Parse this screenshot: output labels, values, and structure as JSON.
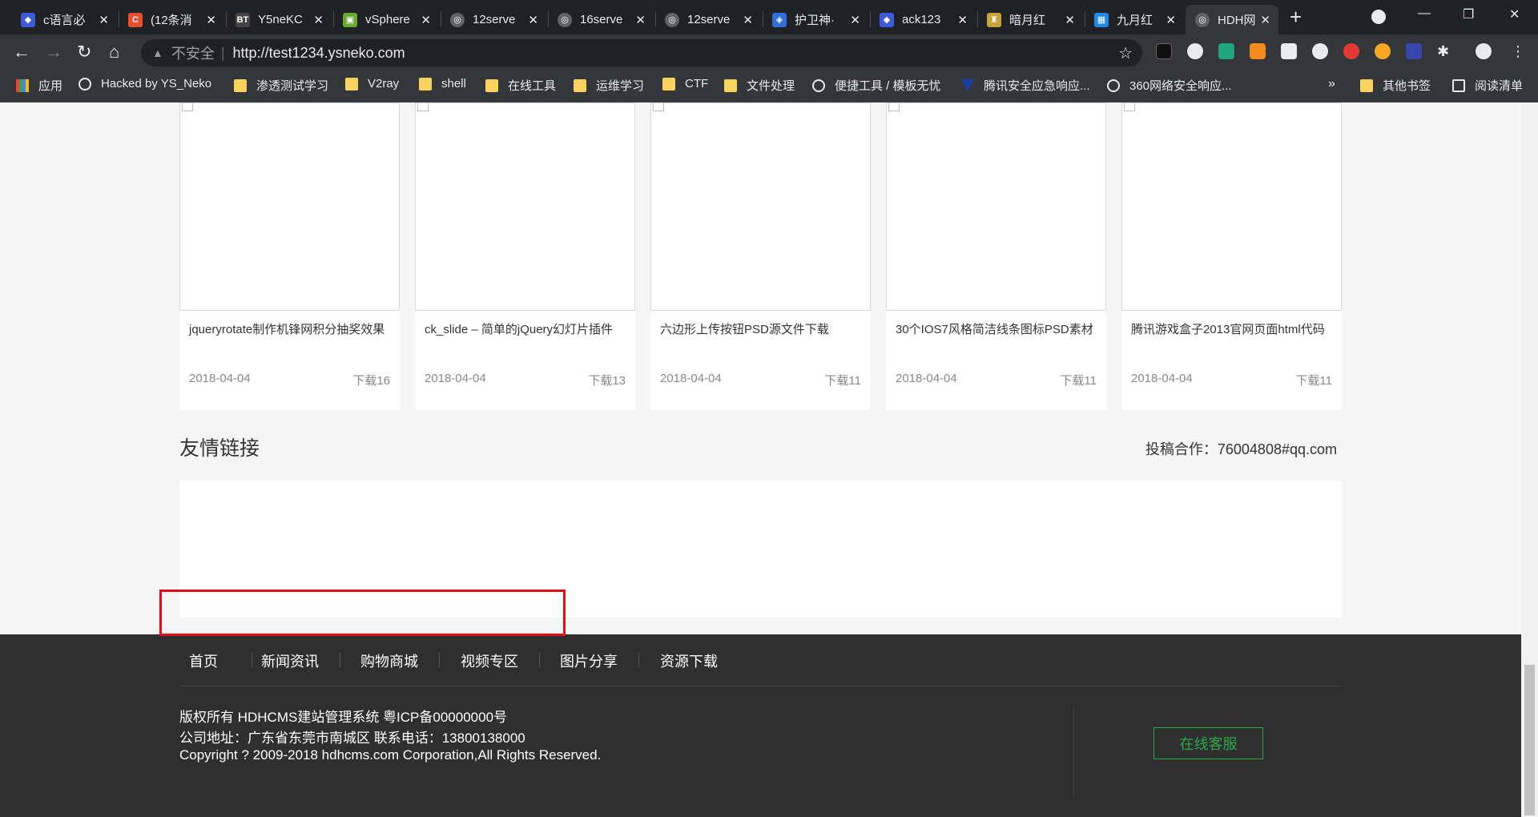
{
  "browser": {
    "tabs": [
      {
        "label": "c语言必",
        "color": "#3b5bdb",
        "glyph": "◆"
      },
      {
        "label": "(12条消",
        "color": "#e8502d",
        "glyph": "C"
      },
      {
        "label": "Y5neKC",
        "color": "#444444",
        "glyph": "BT"
      },
      {
        "label": "vSphere",
        "color": "#6aa92f",
        "glyph": "▣"
      },
      {
        "label": "12serve",
        "color": "#9aa0a6",
        "glyph": "◎"
      },
      {
        "label": "16serve",
        "color": "#9aa0a6",
        "glyph": "◎"
      },
      {
        "label": "12serve",
        "color": "#9aa0a6",
        "glyph": "◎"
      },
      {
        "label": "护卫神·",
        "color": "#2f6fd6",
        "glyph": "◈"
      },
      {
        "label": "ack123",
        "color": "#3b5bdb",
        "glyph": "◆"
      },
      {
        "label": "暗月红",
        "color": "#c9a33a",
        "glyph": "♜"
      },
      {
        "label": "九月红",
        "color": "#1e88e5",
        "glyph": "▦"
      },
      {
        "label": "HDH网",
        "color": "#9aa0a6",
        "glyph": "◎"
      }
    ],
    "address": {
      "insecure_label": "不安全",
      "url": "http://test1234.ysneko.com"
    },
    "bookmarks": [
      {
        "label": "应用",
        "icon": "apps-grid-icon"
      },
      {
        "label": "Hacked by YS_Neko",
        "icon": "globe-icon"
      },
      {
        "label": "渗透测试学习",
        "icon": "folder-icon"
      },
      {
        "label": "V2ray",
        "icon": "folder-icon"
      },
      {
        "label": "shell",
        "icon": "folder-icon"
      },
      {
        "label": "在线工具",
        "icon": "folder-icon"
      },
      {
        "label": "运维学习",
        "icon": "folder-icon"
      },
      {
        "label": "CTF",
        "icon": "folder-icon"
      },
      {
        "label": "文件处理",
        "icon": "folder-icon"
      },
      {
        "label": "便捷工具 / 模板无忧",
        "icon": "globe-icon"
      },
      {
        "label": "腾讯安全应急响应...",
        "icon": "shield-icon"
      },
      {
        "label": "360网络安全响应...",
        "icon": "globe-icon"
      }
    ],
    "overflow_label": "»",
    "other_bookmarks": "其他书签",
    "reading_list": "阅读清单"
  },
  "cards": [
    {
      "title": "jqueryrotate制作机锋网积分抽奖效果",
      "date": "2018-04-04",
      "downloads": "下载16"
    },
    {
      "title": "ck_slide – 简单的jQuery幻灯片插件",
      "date": "2018-04-04",
      "downloads": "下载13"
    },
    {
      "title": "六边形上传按钮PSD源文件下载",
      "date": "2018-04-04",
      "downloads": "下载11"
    },
    {
      "title": "30个IOS7风格简洁线条图标PSD素材",
      "date": "2018-04-04",
      "downloads": "下载11"
    },
    {
      "title": "腾讯游戏盒子2013官网页面html代码",
      "date": "2018-04-04",
      "downloads": "下载11"
    }
  ],
  "links_section": {
    "title": "友情链接",
    "contact": "投稿合作：76004808#qq.com"
  },
  "footer": {
    "nav": [
      "首页",
      "新闻资讯",
      "购物商城",
      "视频专区",
      "图片分享",
      "资源下载"
    ],
    "copyright": "版权所有 HDHCMS建站管理系统 粤ICP备00000000号",
    "address": "公司地址：广东省东莞市南城区 联系电话：13800138000",
    "copyright_en": "Copyright ? 2009-2018 hdhcms.com Corporation,All Rights Reserved.",
    "service_button": "在线客服"
  },
  "colors": {
    "footer_bg": "#2f2f2f",
    "service_green": "#2aa84a",
    "highlight_red": "#e0101a"
  }
}
